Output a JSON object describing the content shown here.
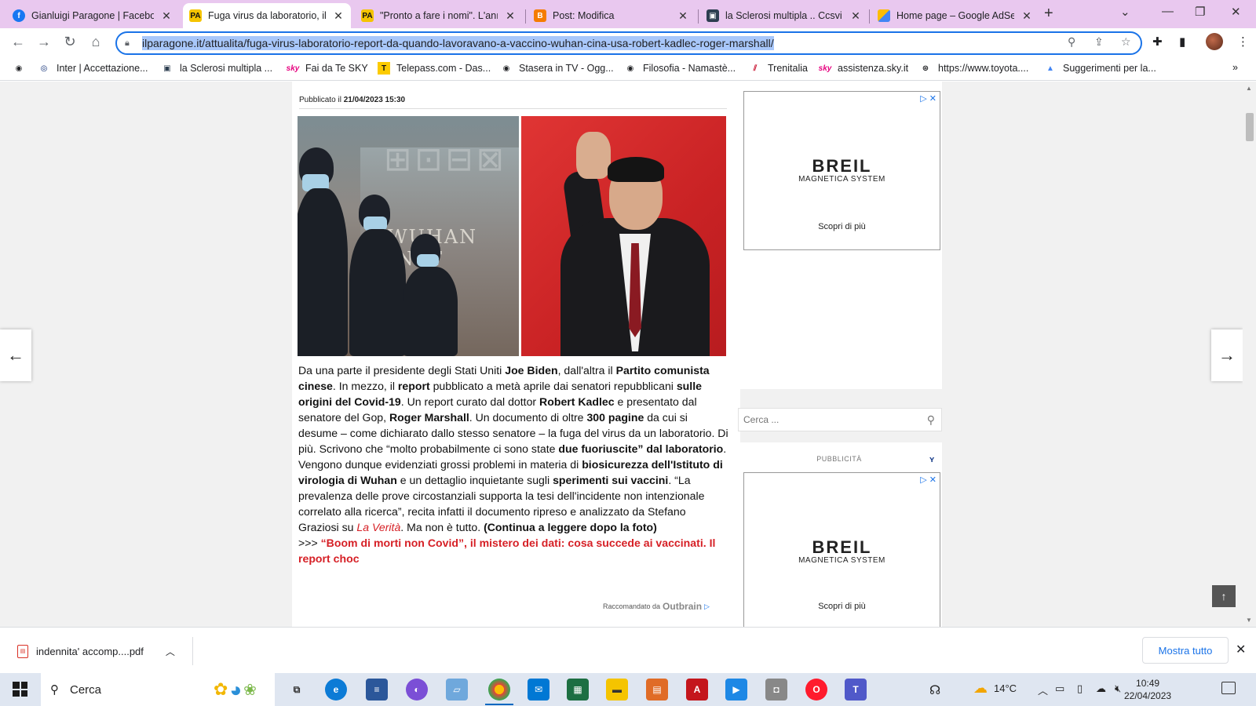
{
  "browser": {
    "tabs": [
      {
        "label": "Gianluigi Paragone | Facebo",
        "icon": "facebook-icon",
        "color": "#1877f2"
      },
      {
        "label": "Fuga virus da laboratorio, il",
        "icon": "ilparagone-icon",
        "color": "#f5c400",
        "active": true
      },
      {
        "label": "\"Pronto a fare i nomi\". L'anı",
        "icon": "ilparagone-icon",
        "color": "#f5c400"
      },
      {
        "label": "Post: Modifica",
        "icon": "blogger-icon",
        "color": "#f57c00"
      },
      {
        "label": "la Sclerosi multipla .. Ccsvi ",
        "icon": "page-icon",
        "color": "#2d3e50"
      },
      {
        "label": "Home page – Google AdSe",
        "icon": "adsense-icon",
        "color": "#4285f4"
      }
    ],
    "url": "ilparagone.it/attualita/fuga-virus-laboratorio-report-da-quando-lavoravano-a-vaccino-wuhan-cina-usa-robert-kadlec-roger-marshall/",
    "bookmarks": [
      {
        "label": "Inter | Accettazione..."
      },
      {
        "label": "la Sclerosi multipla ..."
      },
      {
        "label": "Fai da Te SKY"
      },
      {
        "label": "Telepass.com - Das..."
      },
      {
        "label": "Stasera in TV - Ogg..."
      },
      {
        "label": "Filosofia - Namastè..."
      },
      {
        "label": "Trenitalia"
      },
      {
        "label": "assistenza.sky.it"
      },
      {
        "label": "https://www.toyota...."
      },
      {
        "label": "Suggerimenti per la..."
      }
    ]
  },
  "article": {
    "published_label": "Pubblicato il",
    "published_date": "21/04/2023 15:30",
    "photo_sign": "WUHAN INST",
    "p1": "Da una parte il presidente degli Stati Uniti ",
    "b1": "Joe Biden",
    "p2": ", dall'altra il ",
    "b2": "Partito comunista cinese",
    "p3": ". In mezzo, il ",
    "b3": "report",
    "p4": " pubblicato a metà aprile dai senatori repubblicani ",
    "b4": "sulle origini del Covid-19",
    "p5": ". Un report curato dal dottor ",
    "b5": "Robert Kadlec",
    "p6": " e presentato dal senatore del Gop, ",
    "b6": "Roger Marshall",
    "p7": ". Un documento di oltre ",
    "b7": "300 pagine",
    "p8": " da cui si desume – come dichiarato dallo stesso senatore – la fuga del virus da un laboratorio. Di più. Scrivono che “molto probabilmente ci sono state ",
    "b8": "due fuoriuscite” dal laboratorio",
    "p9": ". Vengono dunque evidenziati grossi problemi in materia di ",
    "b9": "biosicurezza dell'Istituto di virologia di Wuhan",
    "p10": " e un dettaglio inquietante sugli ",
    "b10": "sperimenti sui vaccini",
    "p11": ". “La prevalenza delle prove circostanziali supporta la tesi dell'incidente non intenzionale correlato alla ricerca”, recita infatti il documento ripreso e analizzato da Stefano Graziosi su ",
    "source": "La Verità",
    "p12": ". Ma non è tutto. ",
    "b12": "(Continua a leggere dopo la foto)",
    "link_prefix": ">>> ",
    "link_text": "“Boom di morti non Covid”, il mistero dei dati: cosa succede ai vaccinati. Il report choc",
    "outbrain_label": "Raccomandato da",
    "outbrain_brand": "Outbrain"
  },
  "sidebar": {
    "ad1": {
      "brand": "BREIL",
      "sub": "MAGNETICA SYSTEM",
      "cta": "Scopri di più"
    },
    "search_placeholder": "Cerca ...",
    "pub_label": "PUBBLICITÀ",
    "ad2": {
      "brand": "BREIL",
      "sub": "MAGNETICA SYSTEM",
      "cta": "Scopri di più"
    }
  },
  "downloads": {
    "file": "indennita' accomp....pdf",
    "show_all": "Mostra tutto"
  },
  "taskbar": {
    "search": "Cerca",
    "temperature": "14°C",
    "time": "10:49",
    "date": "22/04/2023"
  }
}
